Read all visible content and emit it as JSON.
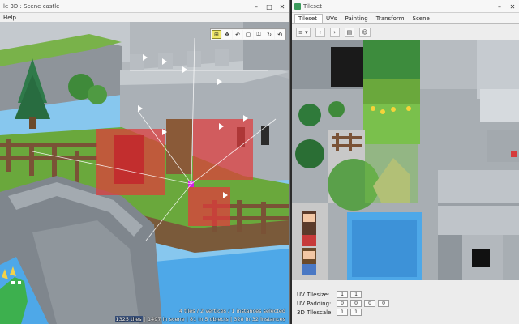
{
  "left_window": {
    "title": "le 3D : Scene castle",
    "menu": [
      "Help"
    ],
    "toolbar": [
      "grid-snap-icon",
      "move-icon",
      "undo-icon",
      "frame-icon",
      "lock-icon",
      "rotate-icon",
      "refresh-icon"
    ],
    "status_selected": "4 tiles / 2 vertices / 1 instances selected",
    "status_scene_prefix": "1325 tiles",
    "status_scene_rest": " | 1497 in scene | 81 in 5 objects | 328 in 32 instances"
  },
  "right_window": {
    "title": "Tileset",
    "tabs": [
      {
        "label": "Tileset",
        "active": true
      },
      {
        "label": "UVs",
        "active": false
      },
      {
        "label": "Painting",
        "active": false
      },
      {
        "label": "Transform",
        "active": false
      },
      {
        "label": "Scene",
        "active": false
      }
    ],
    "toolbar_icons": [
      "menu-icon",
      "back-icon",
      "forward-icon",
      "page-icon",
      "person-icon"
    ],
    "properties": [
      {
        "label": "UV Tilesize:",
        "values": [
          "1",
          "1"
        ]
      },
      {
        "label": "UV Padding:",
        "values": [
          "0",
          "0",
          "0",
          "0"
        ]
      },
      {
        "label": "3D Tilescale:",
        "values": [
          "1",
          "1"
        ]
      }
    ]
  },
  "colors": {
    "sky": "#87c7ee",
    "grass": "#6aa83c",
    "stone": "#9aa0a7",
    "water": "#4ea8e8",
    "selection": "#e03c3c",
    "tileset_bg": "#a8aeb3"
  }
}
